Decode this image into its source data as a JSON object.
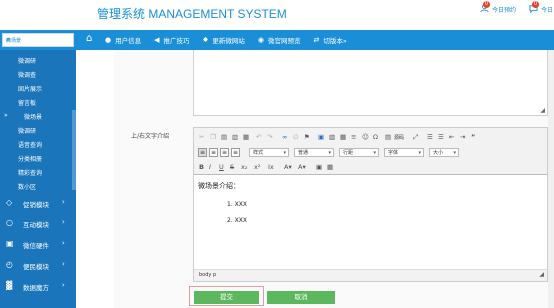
{
  "header": {
    "title": "管理系统 MANAGEMENT SYSTEM",
    "actions": [
      {
        "label": "今日预约",
        "badge": "0",
        "icon": "person-icon"
      },
      {
        "label": "今日",
        "badge": "0",
        "icon": "chat-icon"
      }
    ]
  },
  "search": {
    "placeholder": "微场景",
    "icon": "search-icon"
  },
  "nav": {
    "home_icon": "home-icon",
    "items": [
      {
        "label": "用户信息",
        "icon": "user-icon"
      },
      {
        "label": "推广技巧",
        "icon": "megaphone-icon"
      },
      {
        "label": "更新微网站",
        "icon": "globe-icon"
      },
      {
        "label": "微官网预览",
        "icon": "eye-icon"
      },
      {
        "label": "切版本»",
        "icon": "switch-icon"
      }
    ]
  },
  "sidebar": {
    "sub_items": [
      "微调研",
      "微调查",
      "图片展示",
      "留言板",
      "微场景",
      "微调研",
      "微调查",
      "图片展示",
      "留言板",
      "数据统计"
    ],
    "sub_items_display": [
      "微调研",
      "微调查",
      "固片展示",
      "留言板",
      "微场景",
      "微调研",
      "语音查询",
      "分类相册",
      "精彩查询",
      "数小区"
    ],
    "active_index": 4,
    "modules": [
      {
        "label": "促销模块",
        "icon": "tag-icon"
      },
      {
        "label": "互动模块",
        "icon": "chat-bubble-icon"
      },
      {
        "label": "微信硬件",
        "icon": "device-icon"
      },
      {
        "label": "便民模块",
        "icon": "clock-icon"
      },
      {
        "label": "数据魔方",
        "icon": "chart-icon"
      }
    ]
  },
  "form": {
    "field_label": "上/右文字介绍",
    "toolbar": {
      "source_label": "源码",
      "style_select": "样式",
      "format_select": "普通",
      "font_select": "字体",
      "size_select": "大小",
      "line_select": "行距"
    },
    "editor": {
      "heading": "微场景介绍：",
      "list": [
        "1. XXX",
        "2. XXX"
      ],
      "status": "body  p"
    },
    "submit_label": "提交",
    "cancel_label": "取消"
  },
  "colors": {
    "brand": "#1a8fd8",
    "sidebar": "#1b75bb",
    "button": "#5cb85c",
    "badge": "#e8402a"
  }
}
